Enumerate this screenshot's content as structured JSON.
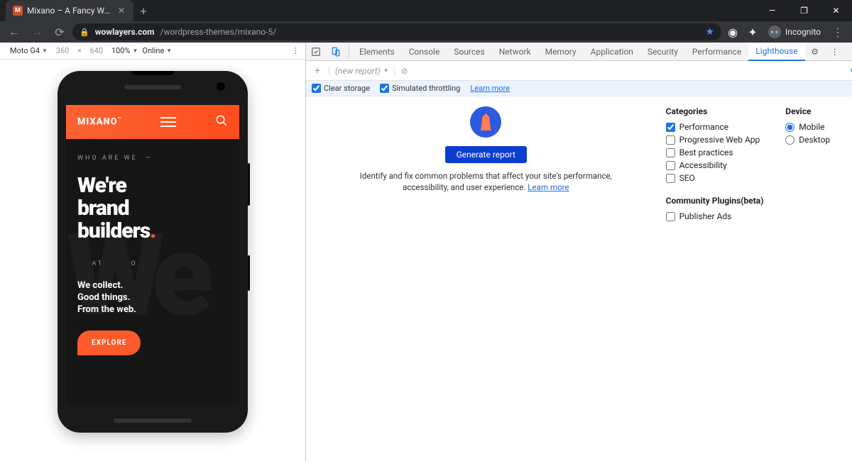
{
  "browser": {
    "tab_title": "Mixano – A Fancy WordPress The",
    "tab_favicon_letter": "M",
    "url_host": "wowlayers.com",
    "url_path": "/wordpress-themes/mixano-5/",
    "incognito_label": "Incognito"
  },
  "device_toolbar": {
    "device": "Moto G4",
    "width": "360",
    "height": "640",
    "zoom": "100%",
    "throttle": "Online"
  },
  "site": {
    "logo": "MIXANO",
    "logo_sup": "™",
    "eyebrow1": "WHO ARE WE",
    "headline_l1": "We're",
    "headline_l2": "brand",
    "headline_l3": "builders",
    "dot": ".",
    "eyebrow2": "WHAT WE DO",
    "sub_l1": "We collect.",
    "sub_l2": "Good things.",
    "sub_l3": "From the web.",
    "cta": "EXPLORE",
    "ghost": "We"
  },
  "devtools": {
    "tabs": [
      "Elements",
      "Console",
      "Sources",
      "Network",
      "Memory",
      "Application",
      "Security",
      "Performance",
      "Lighthouse"
    ],
    "active_tab": "Lighthouse",
    "new_report": "(new report)",
    "opt_clear": "Clear storage",
    "opt_throttle": "Simulated throttling",
    "opt_learn": "Learn more",
    "generate": "Generate report",
    "desc": "Identify and fix common problems that affect your site's performance, accessibility, and user experience.",
    "learn_more": "Learn more",
    "categories_h": "Categories",
    "categories": [
      {
        "label": "Performance",
        "checked": true
      },
      {
        "label": "Progressive Web App",
        "checked": false
      },
      {
        "label": "Best practices",
        "checked": false
      },
      {
        "label": "Accessibility",
        "checked": false
      },
      {
        "label": "SEO",
        "checked": false
      }
    ],
    "device_h": "Device",
    "devices": [
      {
        "label": "Mobile",
        "checked": true
      },
      {
        "label": "Desktop",
        "checked": false
      }
    ],
    "plugins_h": "Community Plugins(beta)",
    "plugins": [
      {
        "label": "Publisher Ads",
        "checked": false
      }
    ]
  }
}
